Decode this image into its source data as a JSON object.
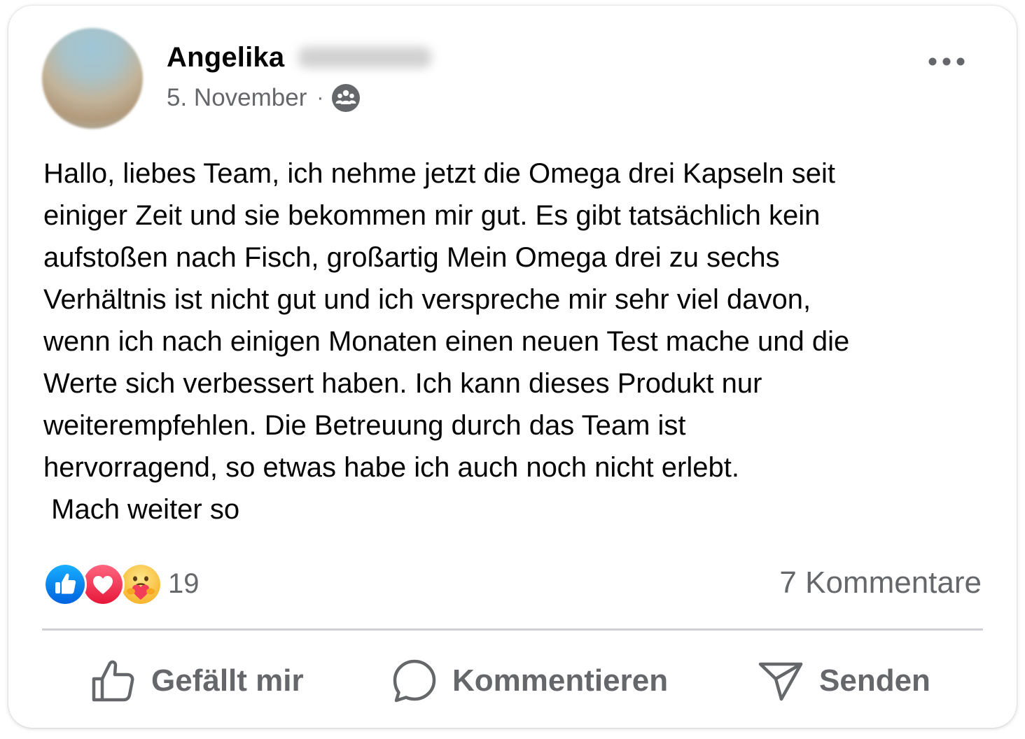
{
  "post": {
    "author_first_name": "Angelika",
    "date": "5. November",
    "separator": "·",
    "audience_icon": "group-icon",
    "more_icon": "more-options-icon",
    "text": "Hallo, liebes Team, ich nehme jetzt die Omega drei Kapseln seit\neiniger Zeit und sie bekommen mir gut. Es gibt tatsächlich kein\naufstoßen nach Fisch, großartig Mein Omega drei zu sechs\nVerhältnis ist nicht gut und ich verspreche mir sehr viel davon,\nwenn ich nach einigen Monaten einen neuen Test mache und die\nWerte sich verbessert haben. Ich kann dieses Produkt nur\nweiterempfehlen. Die Betreuung durch das Team ist\nhervorragend, so etwas habe ich auch noch nicht erlebt.\n Mach weiter so"
  },
  "reactions": {
    "types": [
      "like-icon",
      "love-icon",
      "care-icon"
    ],
    "count": "19"
  },
  "comments_count_label": "7 Kommentare",
  "actions": {
    "like_label": "Gefällt mir",
    "comment_label": "Kommentieren",
    "send_label": "Senden"
  },
  "colors": {
    "like_blue": "#1877f2",
    "love_red": "#f33e58",
    "care_yellow": "#f7b125",
    "secondary_text": "#65676b"
  }
}
